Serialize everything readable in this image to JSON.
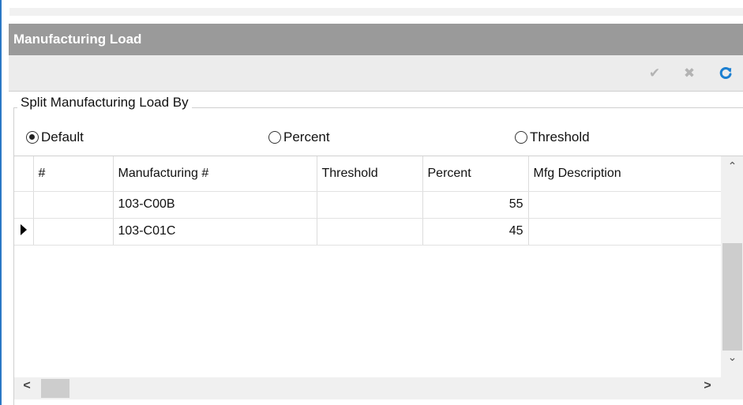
{
  "panel": {
    "title": "Manufacturing Load"
  },
  "toolbar": {
    "accept_icon": "checkmark-icon",
    "cancel_icon": "close-icon",
    "refresh_icon": "refresh-icon",
    "accept_glyph": "✔",
    "cancel_glyph": "✖",
    "refresh_color": "#1b7fd1"
  },
  "split": {
    "legend": "Split Manufacturing Load By",
    "options": [
      {
        "label": "Default",
        "selected": true
      },
      {
        "label": "Percent",
        "selected": false
      },
      {
        "label": "Threshold",
        "selected": false
      }
    ]
  },
  "grid": {
    "columns": [
      "#",
      "Manufacturing #",
      "Threshold",
      "Percent",
      "Mfg Description"
    ],
    "rows": [
      {
        "num": "",
        "mfg": "103-C00B",
        "threshold": "",
        "percent": "55",
        "desc": "",
        "current": false
      },
      {
        "num": "",
        "mfg": "103-C01C",
        "threshold": "",
        "percent": "45",
        "desc": "",
        "current": true
      }
    ]
  },
  "scrollbars": {
    "up_glyph": "⌃",
    "down_glyph": "⌄",
    "left_glyph": "<",
    "right_glyph": ">"
  }
}
